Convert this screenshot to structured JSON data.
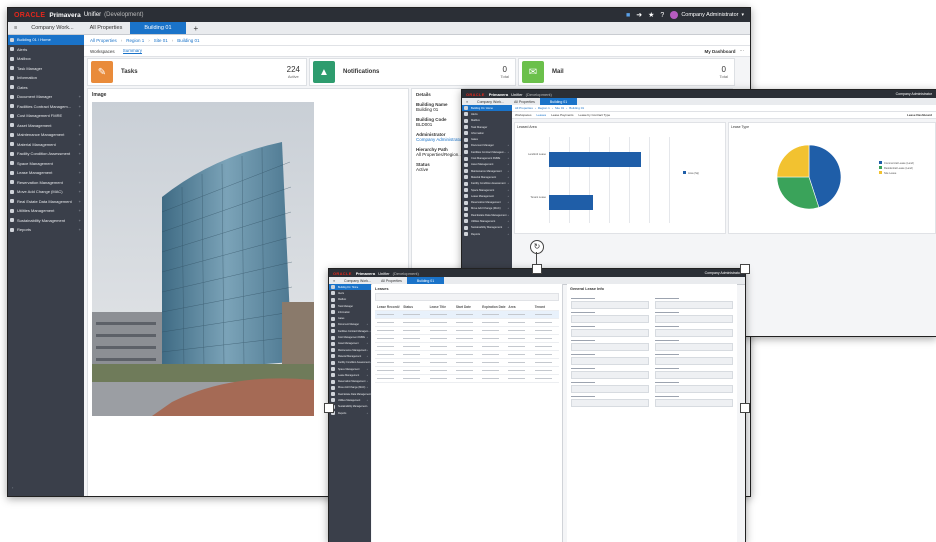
{
  "app": {
    "brand": "ORACLE",
    "product": "Primavera",
    "name": "Unifier",
    "env": "(Development)"
  },
  "user": {
    "name": "Company Administrator"
  },
  "tabs": {
    "company": "Company Work...",
    "all_properties": "All Properties",
    "building": "Building 01",
    "add": "+"
  },
  "breadcrumb": [
    "All Properties",
    "Region 1",
    "Site 01",
    "Building 01"
  ],
  "subtabs": {
    "workspaces": "Workspaces",
    "summary": "Summary",
    "dashboard": "My Dashboard"
  },
  "sidebar": {
    "items": [
      {
        "label": "Building 01 / Home"
      },
      {
        "label": "Alerts"
      },
      {
        "label": "Mailbox"
      },
      {
        "label": "Task Manager"
      },
      {
        "label": "Information"
      },
      {
        "label": "Gates"
      },
      {
        "label": "Document Manager"
      },
      {
        "label": "Facilities Contract Managem..."
      },
      {
        "label": "Cost Management FMRE"
      },
      {
        "label": "Asset Management"
      },
      {
        "label": "Maintenance Management"
      },
      {
        "label": "Material Management"
      },
      {
        "label": "Facility Condition Assessment"
      },
      {
        "label": "Space Management"
      },
      {
        "label": "Lease Management"
      },
      {
        "label": "Reservation Management"
      },
      {
        "label": "Move Add Change (MAC)"
      },
      {
        "label": "Real Estate Data Management"
      },
      {
        "label": "Utilities Management"
      },
      {
        "label": "Sustainability Management"
      },
      {
        "label": "Reports"
      }
    ]
  },
  "cards": {
    "tasks": {
      "label": "Tasks",
      "value": "224",
      "sub": "Active"
    },
    "notifications": {
      "label": "Notifications",
      "value": "0",
      "sub": "Total"
    },
    "mail": {
      "label": "Mail",
      "value": "0",
      "sub": "Total"
    }
  },
  "image_panel": {
    "title": "Image"
  },
  "details": {
    "title": "Details",
    "fields": [
      {
        "label": "Building Name",
        "value": "Building 01"
      },
      {
        "label": "Building Code",
        "value": "BLD001"
      },
      {
        "label": "Administrator",
        "value": "Company Administrator"
      },
      {
        "label": "Hierarchy Path",
        "value": "All Properties/Region..."
      },
      {
        "label": "Status",
        "value": "Active"
      }
    ]
  },
  "window2": {
    "subtabs": [
      "Workspaces",
      "Leases",
      "Lease Payments",
      "Lease by Contract Type"
    ],
    "lease_chart": {
      "title": "Leased Area",
      "legend": "Area (Sq)"
    },
    "lease_type": {
      "title": "Lease Type",
      "dashboard": "Lease Dashboard",
      "legend": [
        "Commercial Lease (Land)",
        "Residential Lease (Land)",
        "Site Lease"
      ]
    }
  },
  "window3": {
    "list_title": "Leases",
    "columns": [
      "Lease Record#",
      "Status",
      "Lease Title",
      "Start Date",
      "Expiration Date",
      "Area",
      "Tenant"
    ],
    "detail_title": "General Lease Info"
  },
  "chart_data": [
    {
      "type": "bar",
      "title": "Leased Area",
      "categories": [
        "Landlord Lease",
        "Tenant Lease"
      ],
      "values": [
        2.3,
        1.1
      ],
      "legend": "Area (Sq)"
    },
    {
      "type": "pie",
      "title": "Lease Type",
      "categories": [
        "Commercial Lease (Land)",
        "Residential Lease (Land)",
        "Site Lease"
      ],
      "values": [
        45,
        30,
        25
      ],
      "colors": [
        "#1f5ea8",
        "#3aa35a",
        "#f2c230"
      ]
    }
  ]
}
